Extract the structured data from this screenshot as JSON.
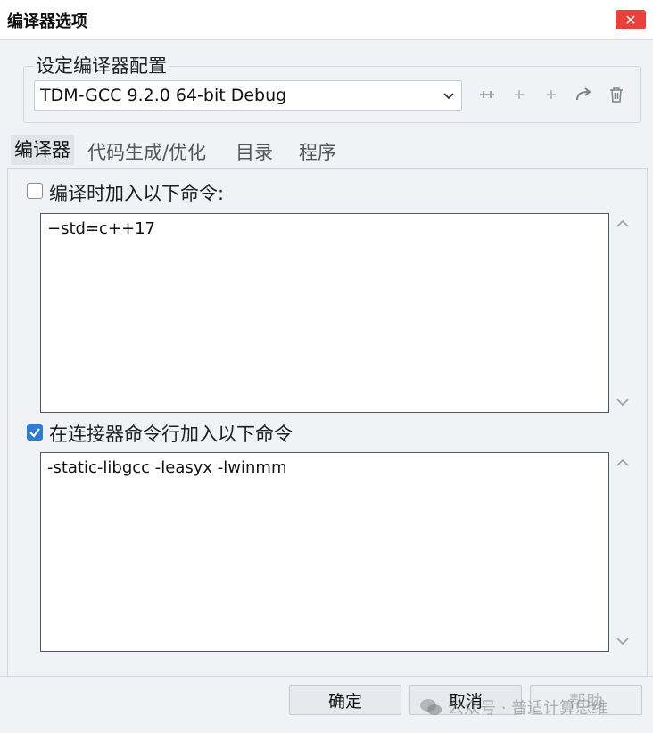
{
  "window": {
    "title": "编译器选项",
    "close_glyph": "✕"
  },
  "config_group": {
    "label": "设定编译器配置",
    "selected": "TDM-GCC 9.2.0 64-bit Debug"
  },
  "toolbar_icons": [
    "add-config-icon",
    "plus-icon",
    "plus-icon",
    "rename-arrow-icon",
    "trash-icon"
  ],
  "tabs": [
    {
      "label": "编译器"
    },
    {
      "label": "代码生成/优化"
    },
    {
      "label": "目录"
    },
    {
      "label": "程序"
    }
  ],
  "compiler_commands": {
    "label": "编译时加入以下命令:",
    "checked": false,
    "value": "−std=c++17"
  },
  "linker_commands": {
    "label": "在连接器命令行加入以下命令",
    "checked": true,
    "value": "-static-libgcc -leasyx -lwinmm"
  },
  "buttons": {
    "ok": "确定",
    "cancel": "取消",
    "help": "帮助"
  },
  "watermark": "公众号 · 普适计算思维",
  "colors": {
    "accent": "#2e7cd6",
    "close": "#e8403a"
  }
}
